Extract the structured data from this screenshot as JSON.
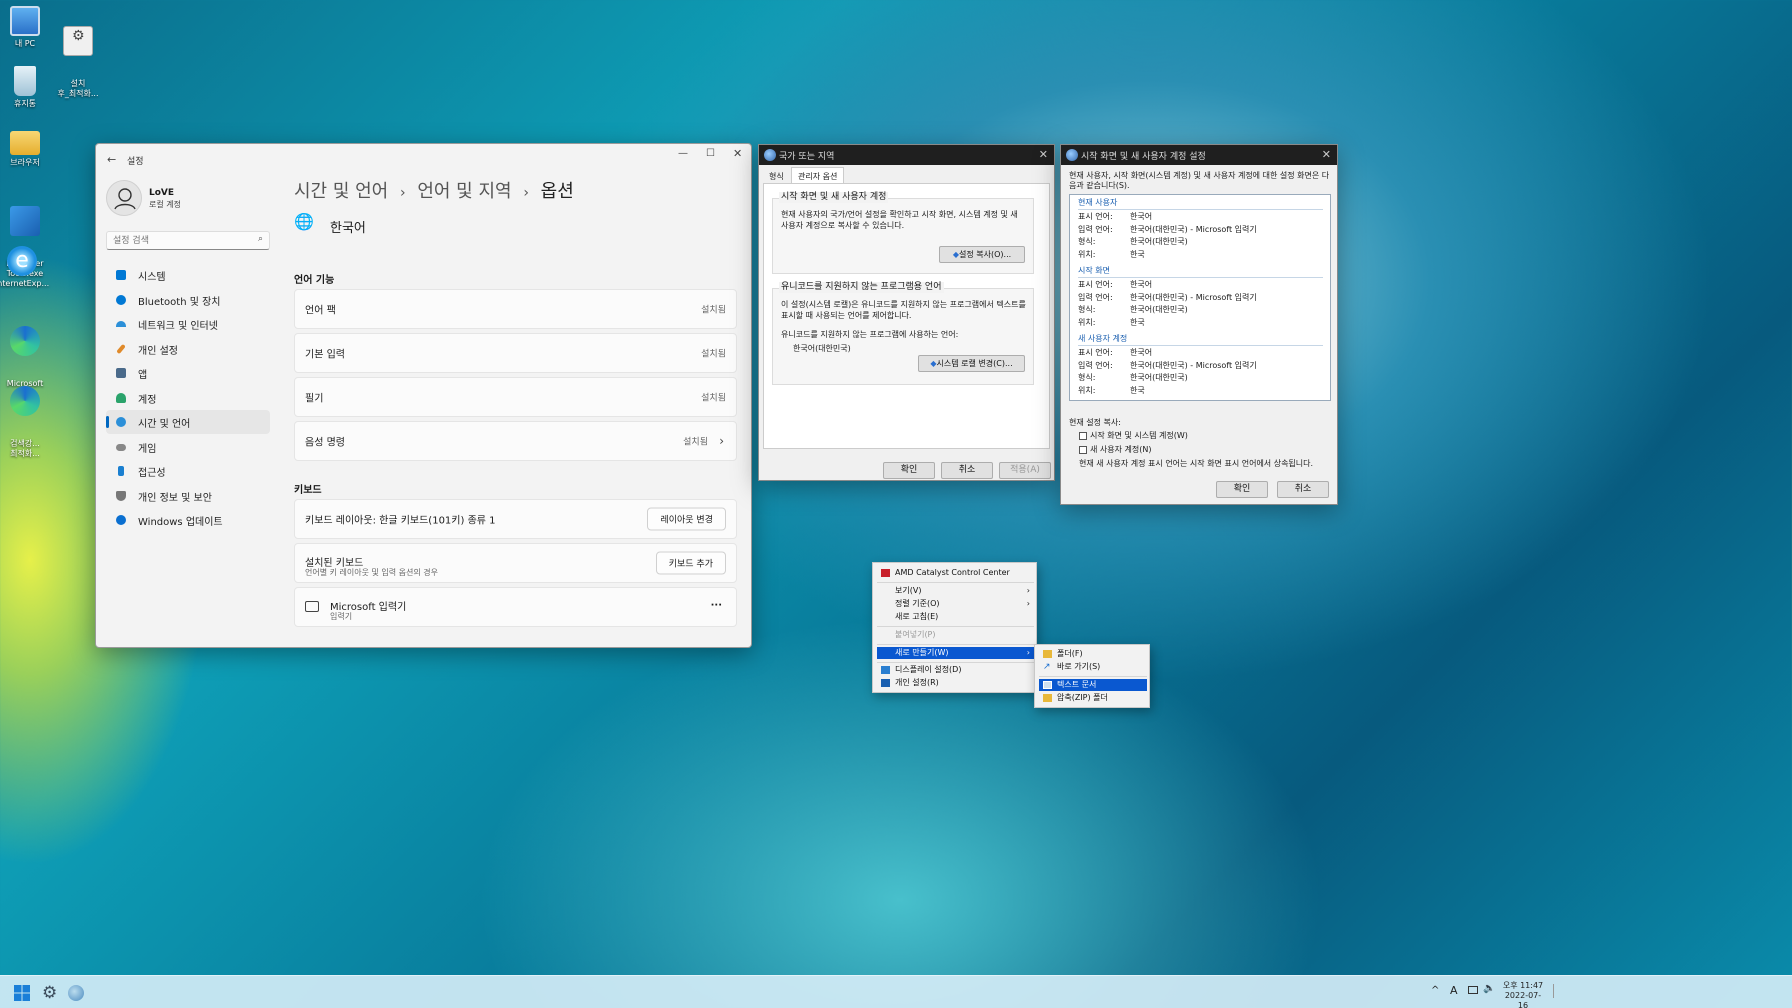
{
  "desktop": {
    "icons": [
      {
        "label": "내 PC",
        "color": "#3b8fd6"
      },
      {
        "label": "설치\n후_최적화...",
        "color": "#e8e8e8"
      },
      {
        "label": "휴지통",
        "color": "#cfe3ee"
      },
      {
        "label": "브라우저",
        "color": "#f2c94c"
      },
      {
        "label": "Defender\nTools.exe",
        "color": "#2d7dd2"
      },
      {
        "label": "InternetExp...",
        "color": "#1e90e0"
      },
      {
        "label": "Microsoft\nEdge",
        "color": "#1aa1a8"
      },
      {
        "label": "검색강...\n최적화...",
        "color": "#1aa1a8"
      }
    ]
  },
  "settings": {
    "app_title": "설정",
    "user": {
      "name": "LoVE",
      "type": "로컬 계정"
    },
    "search_placeholder": "설정 검색",
    "nav": [
      {
        "label": "시스템",
        "color": "#0078d4"
      },
      {
        "label": "Bluetooth 및 장치",
        "color": "#0078d4"
      },
      {
        "label": "네트워크 및 인터넷",
        "color": "#2b8fd8"
      },
      {
        "label": "개인 설정",
        "color": "#e08a2a"
      },
      {
        "label": "앱",
        "color": "#4a6a8a"
      },
      {
        "label": "계정",
        "color": "#2aa36b"
      },
      {
        "label": "시간 및 언어",
        "color": "#2b8fd8"
      },
      {
        "label": "게임",
        "color": "#888888"
      },
      {
        "label": "접근성",
        "color": "#1a7fd0"
      },
      {
        "label": "개인 정보 및 보안",
        "color": "#777777"
      },
      {
        "label": "Windows 업데이트",
        "color": "#0a6fd0"
      }
    ],
    "breadcrumb": {
      "part1": "시간 및 언어",
      "part2": "언어 및 지역",
      "part3": "옵션",
      "sep": "›"
    },
    "language": "한국어",
    "section_features": "언어 기능",
    "features": [
      {
        "label": "언어 팩",
        "status": "설치됨"
      },
      {
        "label": "기본 입력",
        "status": "설치됨"
      },
      {
        "label": "필기",
        "status": "설치됨"
      },
      {
        "label": "음성 명령",
        "status": "설치됨"
      }
    ],
    "section_keyboard": "키보드",
    "kb_layout_label": "키보드 레이아웃: 한글 키보드(101키) 종류 1",
    "kb_layout_btn": "레이아웃 변경",
    "installed_kb_label": "설치된 키보드",
    "installed_kb_sub": "언어별 키 레이아웃 및 입력 옵션의 경우",
    "add_kb_btn": "키보드 추가",
    "ime_name": "Microsoft 입력기",
    "ime_sub": "입력기",
    "more": "···"
  },
  "region": {
    "title": "국가 또는 지역",
    "tabs": [
      "형식",
      "관리자 옵션"
    ],
    "group1_title": "시작 화면 및 새 사용자 계정",
    "group1_text": "현재 사용자의 국가/언어 설정을 확인하고 시작 화면, 시스템 계정 및 새 사용자 계정으로 복사할 수 있습니다.",
    "copy_btn": "설정 복사(O)...",
    "group2_title": "유니코드를 지원하지 않는 프로그램용 언어",
    "group2_text": "이 설정(시스템 로캘)은 유니코드를 지원하지 않는 프로그램에서 텍스트를 표시할 때 사용되는 언어를 제어합니다.",
    "group2_label": "유니코드를 지원하지 않는 프로그램에 사용하는 언어:",
    "group2_value": "한국어(대한민국)",
    "locale_btn": "시스템 로캘 변경(C)...",
    "ok": "확인",
    "cancel": "취소",
    "apply": "적용(A)"
  },
  "welcome": {
    "title": "시작 화면 및 새 사용자 계정 설정",
    "intro": "현재 사용자, 시작 화면(시스템 계정) 및 새 사용자 계정에 대한 설정 화면은 다음과 같습니다(S).",
    "sections": [
      {
        "title": "현재 사용자",
        "rows": [
          [
            "표시 언어:",
            "한국어"
          ],
          [
            "입력 언어:",
            "한국어(대한민국) - Microsoft 입력기"
          ],
          [
            "형식:",
            "한국어(대한민국)"
          ],
          [
            "위치:",
            "한국"
          ]
        ]
      },
      {
        "title": "시작 화면",
        "rows": [
          [
            "표시 언어:",
            "한국어"
          ],
          [
            "입력 언어:",
            "한국어(대한민국) - Microsoft 입력기"
          ],
          [
            "형식:",
            "한국어(대한민국)"
          ],
          [
            "위치:",
            "한국"
          ]
        ]
      },
      {
        "title": "새 사용자 계정",
        "rows": [
          [
            "표시 언어:",
            "한국어"
          ],
          [
            "입력 언어:",
            "한국어(대한민국) - Microsoft 입력기"
          ],
          [
            "형식:",
            "한국어(대한민국)"
          ],
          [
            "위치:",
            "한국"
          ]
        ]
      }
    ],
    "copy_label": "현재 설정 복사:",
    "check1": "시작 화면 및 시스템 계정(W)",
    "check2": "새 사용자 계정(N)",
    "note": "현재 새 사용자 계정 표시 언어는 시작 화면 표시 언어에서 상속됩니다.",
    "ok": "확인",
    "cancel": "취소"
  },
  "context_menu": {
    "items": [
      "AMD Catalyst Control Center",
      "보기(V)",
      "정렬 기준(O)",
      "새로 고침(E)",
      "붙여넣기(P)",
      "새로 만들기(W)",
      "디스플레이 설정(D)",
      "개인 설정(R)"
    ],
    "submenu": [
      "폴더(F)",
      "바로 가기(S)",
      "텍스트 문서",
      "압축(ZIP) 폴더"
    ]
  },
  "taskbar": {
    "time": "오후 11:47",
    "date": "2022-07-16",
    "ime": "A"
  }
}
